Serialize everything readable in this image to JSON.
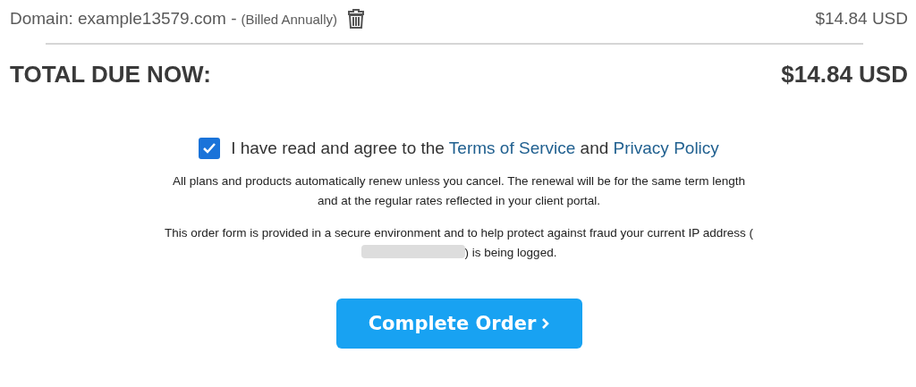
{
  "line_item": {
    "description": "Domain: example13579.com -",
    "billing": "(Billed Annually)",
    "price": "$14.84 USD"
  },
  "total": {
    "label": "TOTAL DUE NOW:",
    "amount": "$14.84 USD"
  },
  "agreement": {
    "checked": true,
    "text_before": "I have read and agree to the",
    "terms_link": "Terms of Service",
    "text_between": "and",
    "privacy_link": "Privacy Policy"
  },
  "notices": [
    "All plans and products automatically renew unless you cancel. The renewal will be for the same term length and at the regular rates reflected in your client portal."
  ],
  "ip_notice": {
    "before": "This order form is provided in a secure environment and to help protect against fraud your current IP address (",
    "after": ") is being logged."
  },
  "submit_button": {
    "label": "Complete Order"
  }
}
